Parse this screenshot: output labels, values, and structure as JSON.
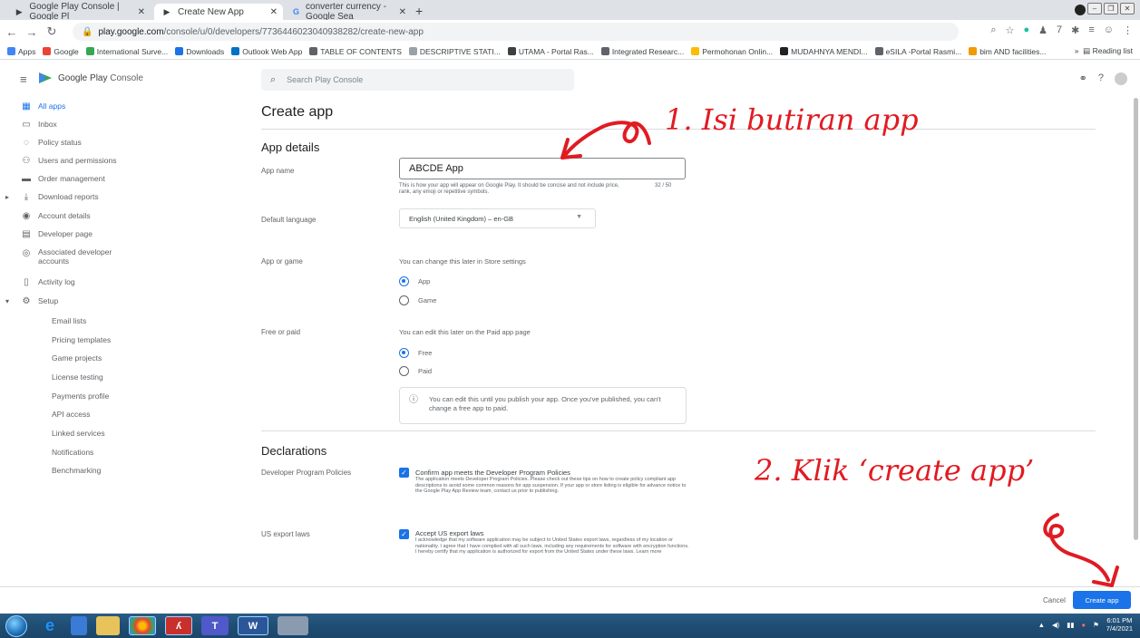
{
  "browser": {
    "tabs": [
      {
        "title": "Google Play Console | Google Pl",
        "active": false
      },
      {
        "title": "Create New App",
        "active": true
      },
      {
        "title": "converter currency - Google Sea",
        "active": false
      }
    ],
    "url_host": "play.google.com",
    "url_path": "/console/u/0/developers/7736446023040938282/create-new-app",
    "bookmarks": [
      "Apps",
      "Google",
      "International Surve...",
      "Downloads",
      "Outlook Web App",
      "TABLE OF CONTENTS",
      "DESCRIPTIVE STATI...",
      "UTAMA - Portal Ras...",
      "Integrated Researc...",
      "Permohonan Onlin...",
      "MUDAHNYA MENDI...",
      "eSILA -Portal Rasmi...",
      "bim AND facilities..."
    ],
    "reading_list": "Reading list"
  },
  "appbar": {
    "brand_strong": "Google Play",
    "brand_light": "Console",
    "search_placeholder": "Search Play Console"
  },
  "sidebar": {
    "items": [
      "All apps",
      "Inbox",
      "Policy status",
      "Users and permissions",
      "Order management",
      "Download reports",
      "Account details",
      "Developer page",
      "Associated developer",
      "accounts",
      "Activity log",
      "Setup"
    ],
    "subitems": [
      "Email lists",
      "Pricing templates",
      "Game projects",
      "License testing",
      "Payments profile",
      "API access",
      "Linked services",
      "Notifications",
      "Benchmarking"
    ]
  },
  "form": {
    "page_title": "Create app",
    "section_app_details": "App details",
    "app_name_label": "App name",
    "app_name_value": "ABCDE App",
    "app_name_helper": "This is how your app will appear on Google Play. It should be concise and not include price, rank, any emoji or repetitive symbols.",
    "app_name_counter": "32 / 50",
    "default_language_label": "Default language",
    "default_language_value": "English (United Kingdom) – en-GB",
    "app_or_game_label": "App or game",
    "app_or_game_hint": "You can change this later in Store settings",
    "option_app": "App",
    "option_game": "Game",
    "free_or_paid_label": "Free or paid",
    "free_or_paid_hint": "You can edit this later on the Paid app page",
    "option_free": "Free",
    "option_paid": "Paid",
    "info_line1": "You can edit this until you publish your app. Once you've published, you can't",
    "info_line2": "change a free app to paid.",
    "section_declarations": "Declarations",
    "dev_policies_label": "Developer Program Policies",
    "dev_policies_title": "Confirm app meets the Developer Program Policies",
    "dev_policies_desc": "The application meets Developer Program Policies. Please check out these tips on how to create policy compliant app descriptions to avoid some common reasons for app suspension. If your app or store listing is eligible for advance notice to the Google Play App Review team, contact us prior to publishing.",
    "us_export_label": "US export laws",
    "us_export_title": "Accept US export laws",
    "us_export_desc": "I acknowledge that my software application may be subject to United States export laws, regardless of my location or nationality. I agree that I have complied with all such laws, including any requirements for software with encryption functions. I hereby certify that my application is authorized for export from the United States under these laws. Learn more"
  },
  "footer": {
    "cancel": "Cancel",
    "create": "Create app"
  },
  "annotations": {
    "step1": "1. Isi butiran app",
    "step2": "2. Klik ‘create app’"
  },
  "taskbar": {
    "time": "6:01 PM",
    "date": "7/4/2021"
  }
}
